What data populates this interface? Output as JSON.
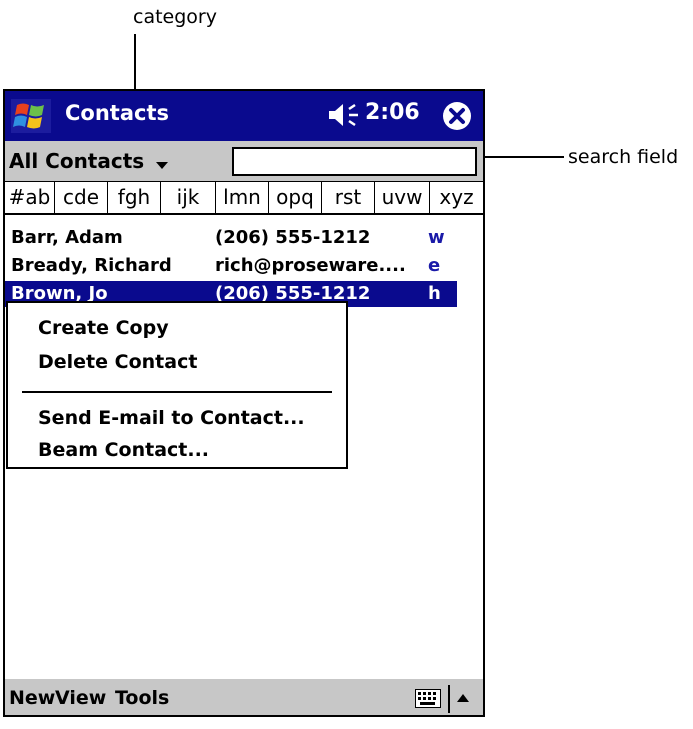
{
  "callouts": {
    "category": "category",
    "search_field": "search field"
  },
  "titlebar": {
    "title": "Contacts",
    "time": "2:06"
  },
  "category_bar": {
    "label": "All Contacts",
    "search_placeholder": ""
  },
  "index_tabs": [
    "#ab",
    "cde",
    "fgh",
    "ijk",
    "lmn",
    "opq",
    "rst",
    "uvw",
    "xyz"
  ],
  "contacts": [
    {
      "name": "Barr, Adam",
      "info": "(206) 555-1212",
      "type": "w"
    },
    {
      "name": "Bready, Richard",
      "info": "rich@proseware....",
      "type": "e"
    },
    {
      "name": "Brown, Jo",
      "info": "(206) 555-1212",
      "type": "h"
    }
  ],
  "context_menu": {
    "items": [
      "Create Copy",
      "Delete Contact",
      "Send E-mail to Contact...",
      "Beam Contact..."
    ]
  },
  "bottom_menu": {
    "items": [
      "New",
      "View",
      "Tools"
    ]
  },
  "colors": {
    "titlebar": "#0a0a8e",
    "bars": "#c7c7c7",
    "selection": "#0a0a8e",
    "type_letter": "#1a1aa8"
  }
}
